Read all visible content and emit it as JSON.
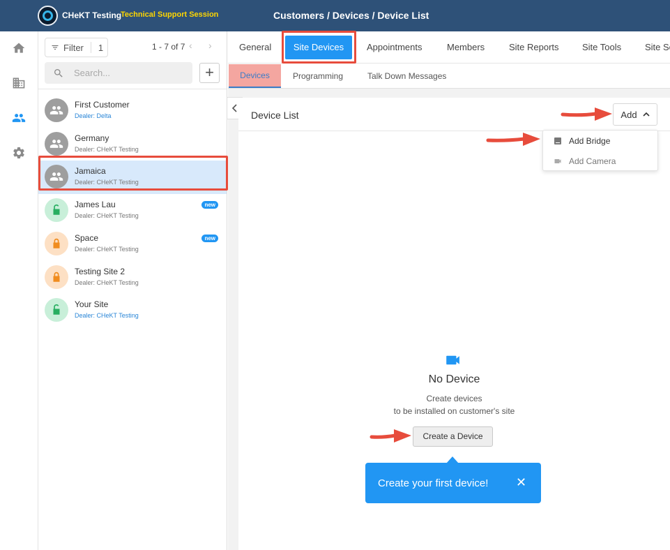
{
  "header": {
    "app_name": "CHeKT Testing",
    "session_label": "Technical Support Session",
    "breadcrumb": "Customers / Devices / Device List"
  },
  "nav_rail": {
    "icons": [
      "home-icon",
      "building-icon",
      "people-icon",
      "gear-icon"
    ],
    "active": "people-icon"
  },
  "customer_list": {
    "filter_label": "Filter",
    "filter_count": "1",
    "pager": "1 - 7 of 7",
    "search_placeholder": "Search...",
    "items": [
      {
        "name": "First Customer",
        "dealer": "Dealer: Delta",
        "avatar": "group",
        "color": "grey",
        "dealer_blue": true,
        "badge": ""
      },
      {
        "name": "Germany",
        "dealer": "Dealer: CHeKT Testing",
        "avatar": "group",
        "color": "grey",
        "dealer_blue": false,
        "badge": ""
      },
      {
        "name": "Jamaica",
        "dealer": "Dealer: CHeKT Testing",
        "avatar": "group",
        "color": "grey",
        "dealer_blue": false,
        "badge": "",
        "selected": true
      },
      {
        "name": "James Lau",
        "dealer": "Dealer: CHeKT Testing",
        "avatar": "unlock",
        "color": "green",
        "dealer_blue": false,
        "badge": "new"
      },
      {
        "name": "Space",
        "dealer": "Dealer: CHeKT Testing",
        "avatar": "lock",
        "color": "orange",
        "dealer_blue": false,
        "badge": "new"
      },
      {
        "name": "Testing Site 2",
        "dealer": "Dealer: CHeKT Testing",
        "avatar": "lock",
        "color": "orange",
        "dealer_blue": false,
        "badge": ""
      },
      {
        "name": "Your Site",
        "dealer": "Dealer: CHeKT Testing",
        "avatar": "unlock",
        "color": "green",
        "dealer_blue": true,
        "badge": ""
      }
    ]
  },
  "tabs": {
    "general": "General",
    "site_devices": "Site Devices",
    "appointments": "Appointments",
    "members": "Members",
    "site_reports": "Site Reports",
    "site_tools": "Site Tools",
    "site_settings": "Site Se"
  },
  "subtabs": {
    "devices": "Devices",
    "programming": "Programming",
    "talk_down": "Talk Down Messages"
  },
  "device_list": {
    "title": "Device List",
    "add_label": "Add",
    "menu": {
      "add_bridge": "Add Bridge",
      "add_camera": "Add Camera"
    },
    "empty_title": "No Device",
    "empty_sub1": "Create devices",
    "empty_sub2": "to be installed on customer's site",
    "create_button": "Create a Device",
    "tooltip": "Create your first device!",
    "tooltip_close": "✕"
  },
  "colors": {
    "header_bg": "#2e5178",
    "accent": "#2196f3",
    "highlight": "#e74c3c",
    "session": "#ffd600"
  }
}
